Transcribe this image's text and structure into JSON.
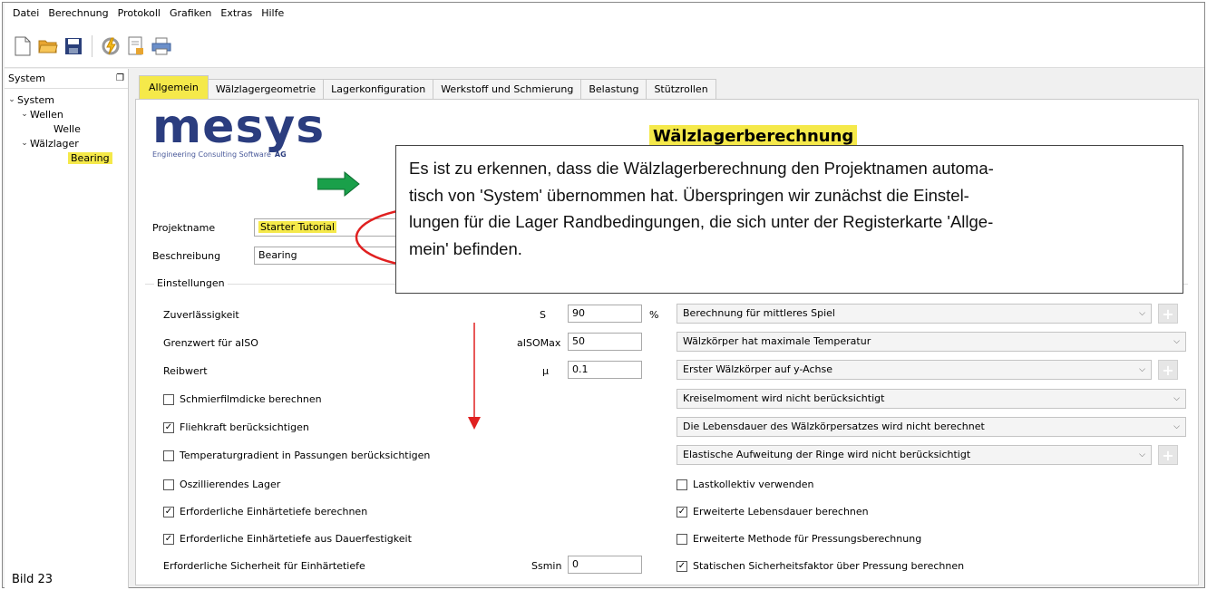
{
  "menu": [
    "Datei",
    "Berechnung",
    "Protokoll",
    "Grafiken",
    "Extras",
    "Hilfe"
  ],
  "toolbar": {
    "icons": [
      "new-file-icon",
      "open-folder-icon",
      "save-icon",
      "calculate-icon",
      "report-icon",
      "print-icon"
    ]
  },
  "left_panel": {
    "title": "System",
    "tree": [
      {
        "label": "System",
        "level": 0,
        "expanded": true
      },
      {
        "label": "Wellen",
        "level": 1,
        "expanded": true
      },
      {
        "label": "Welle",
        "level": 2
      },
      {
        "label": "Wälzlager",
        "level": 1,
        "expanded": true
      },
      {
        "label": "Bearing",
        "level": 2,
        "selected": true
      }
    ]
  },
  "caption": "Bild 23",
  "tabs": [
    {
      "label": "Allgemein",
      "active": true
    },
    {
      "label": "Wälzlagergeometrie"
    },
    {
      "label": "Lagerkonfiguration"
    },
    {
      "label": "Werkstoff und Schmierung"
    },
    {
      "label": "Belastung"
    },
    {
      "label": "Stützrollen"
    }
  ],
  "logo": {
    "name": "mesys",
    "tagline": "Engineering Consulting Software",
    "suffix": "AG"
  },
  "page_title": "Wälzlagerberechnung",
  "callout_text": "Es ist zu erkennen, dass die Wälzlagerberechnung den Projektnamen automa-tisch von 'System' übernommen hat. Überspringen wir zunächst die Einstel-lungen für die Lager Randbedingungen, die sich unter der Registerkarte 'Allge-mein' befinden.",
  "callout_lines": [
    "Es ist zu erkennen, dass die Wälzlagerberechnung den Projektnamen automa-",
    "tisch von 'System' übernommen hat. Überspringen wir zunächst die Einstel-",
    "lungen für die Lager Randbedingungen, die sich unter der Registerkarte 'Allge-",
    "mein' befinden."
  ],
  "project": {
    "name_label": "Projektname",
    "name_value": "Starter Tutorial",
    "desc_label": "Beschreibung",
    "desc_value": "Bearing"
  },
  "settings": {
    "group_title": "Einstellungen",
    "rows": [
      {
        "label": "Zuverlässigkeit",
        "symbol": "S",
        "value": "90",
        "unit": "%"
      },
      {
        "label": "Grenzwert für aISO",
        "symbol": "aISOMax",
        "value": "50",
        "unit": ""
      },
      {
        "label": "Reibwert",
        "symbol": "μ",
        "value": "0.1",
        "unit": ""
      }
    ],
    "checkboxes_left": [
      {
        "label": "Schmierfilmdicke berechnen",
        "checked": false
      },
      {
        "label": "Fliehkraft berücksichtigen",
        "checked": true
      },
      {
        "label": "Temperaturgradient in Passungen berücksichtigen",
        "checked": false
      },
      {
        "label": "Oszillierendes Lager",
        "checked": false
      },
      {
        "label": "Erforderliche Einhärtetiefe berechnen",
        "checked": true
      },
      {
        "label": "Erforderliche Einhärtetiefe aus Dauerfestigkeit",
        "checked": true
      }
    ],
    "ssmin": {
      "label": "Erforderliche Sicherheit für Einhärtetiefe",
      "symbol": "Ssmin",
      "value": "0"
    },
    "selects": [
      {
        "value": "Berechnung für mittleres Spiel",
        "plus": true
      },
      {
        "value": "Wälzkörper hat maximale Temperatur",
        "plus": false
      },
      {
        "value": "Erster Wälzkörper auf y-Achse",
        "plus": true
      },
      {
        "value": "Kreiselmoment wird nicht berücksichtigt",
        "plus": false
      },
      {
        "value": "Die Lebensdauer des Wälzkörpersatzes wird nicht berechnet",
        "plus": false
      },
      {
        "value": "Elastische Aufweitung der Ringe wird nicht berücksichtigt",
        "plus": true
      }
    ],
    "checkboxes_right": [
      {
        "label": "Lastkollektiv verwenden",
        "checked": false
      },
      {
        "label": "Erweiterte Lebensdauer berechnen",
        "checked": true
      },
      {
        "label": "Erweiterte Methode für Pressungsberechnung",
        "checked": false
      },
      {
        "label": "Statischen Sicherheitsfaktor über Pressung berechnen",
        "checked": true
      }
    ]
  },
  "colors": {
    "highlight": "#f5e94a",
    "annotation_red": "#e02020",
    "arrow_green": "#1aa04a"
  }
}
